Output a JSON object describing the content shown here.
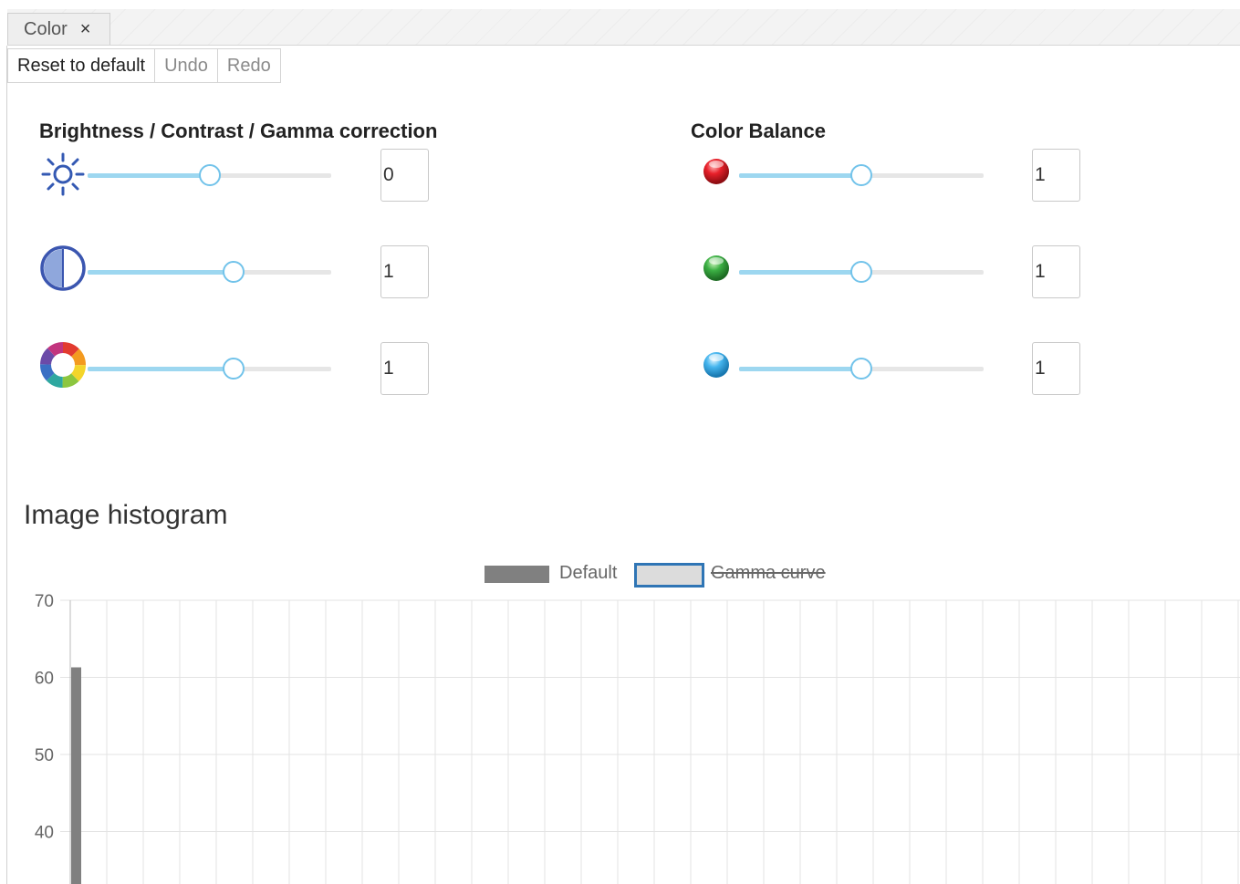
{
  "tab": {
    "title": "Color",
    "close_glyph": "×"
  },
  "toolbar": {
    "reset_label": "Reset to default",
    "undo_label": "Undo",
    "redo_label": "Redo"
  },
  "adjust": {
    "title": "Brightness / Contrast / Gamma correction",
    "rows": [
      {
        "icon": "brightness-sun-icon",
        "value": "0",
        "slider_fraction": 0.5
      },
      {
        "icon": "contrast-icon",
        "value": "1",
        "slider_fraction": 0.6
      },
      {
        "icon": "gamma-color-wheel-icon",
        "value": "1",
        "slider_fraction": 0.6
      }
    ]
  },
  "balance": {
    "title": "Color Balance",
    "rows": [
      {
        "icon": "red-ball-icon",
        "value": "1",
        "slider_fraction": 0.5,
        "color": "#e8202a"
      },
      {
        "icon": "green-ball-icon",
        "value": "1",
        "slider_fraction": 0.5,
        "color": "#3cb044"
      },
      {
        "icon": "blue-ball-icon",
        "value": "1",
        "slider_fraction": 0.5,
        "color": "#45b5ee"
      }
    ]
  },
  "histogram": {
    "title": "Image histogram",
    "legend": [
      {
        "label": "Default",
        "color": "#808080",
        "hidden": false
      },
      {
        "label": "Gamma curve",
        "color": "#dcdcdc",
        "border": "#2f75b5",
        "hidden": true
      }
    ]
  },
  "chart_data": {
    "type": "bar",
    "title": "",
    "xlabel": "",
    "ylabel": "",
    "grid": true,
    "legend_position": "top",
    "yticks": [
      70,
      60,
      50,
      40
    ],
    "ylim": [
      35,
      70
    ],
    "series": [
      {
        "name": "Default",
        "color": "#808080",
        "values": [
          61.3
        ]
      }
    ]
  }
}
